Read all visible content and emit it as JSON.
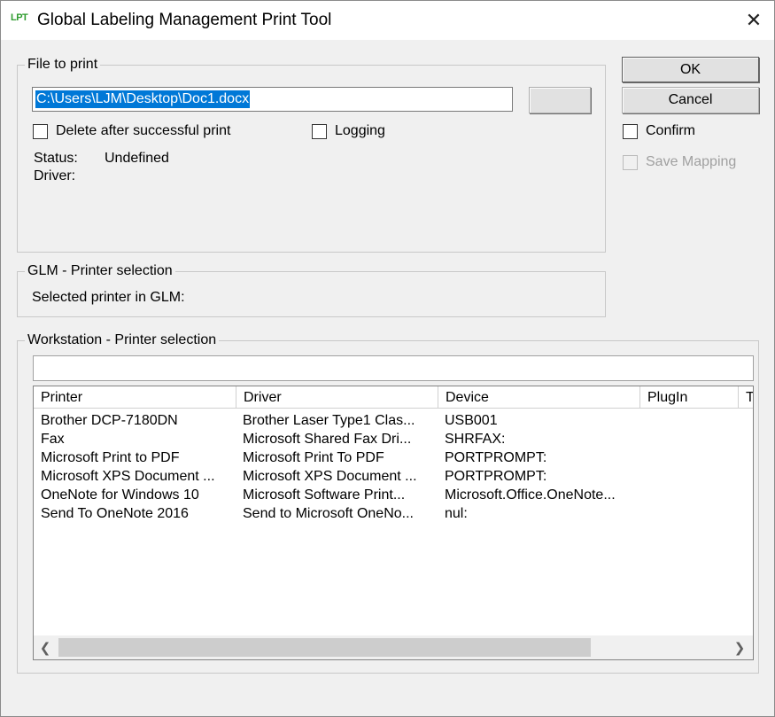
{
  "window": {
    "logo_text": "LPT",
    "title": "Global Labeling Management Print Tool",
    "close_glyph": "✕"
  },
  "file_group": {
    "legend": "File to print",
    "file_path": "C:\\Users\\LJM\\Desktop\\Doc1.docx",
    "browse_label": "",
    "delete_after_label": "Delete after successful print",
    "delete_after_checked": false,
    "logging_label": "Logging",
    "logging_checked": false,
    "status_label": "Status:",
    "status_value": "Undefined",
    "driver_label": "Driver:",
    "driver_value": ""
  },
  "actions": {
    "ok_label": "OK",
    "cancel_label": "Cancel",
    "confirm_label": "Confirm",
    "confirm_checked": false,
    "save_mapping_label": "Save Mapping",
    "save_mapping_enabled": false
  },
  "glm_group": {
    "legend": "GLM - Printer selection",
    "selected_label": "Selected printer in GLM:",
    "selected_value": ""
  },
  "workstation_group": {
    "legend": "Workstation - Printer selection",
    "filter_value": "",
    "columns": [
      "Printer",
      "Driver",
      "Device",
      "PlugIn",
      "T"
    ],
    "rows": [
      [
        "Brother DCP-7180DN",
        "Brother Laser Type1 Clas...",
        "USB001",
        ""
      ],
      [
        "Fax",
        "Microsoft Shared Fax Dri...",
        "SHRFAX:",
        ""
      ],
      [
        "Microsoft Print to PDF",
        "Microsoft Print To PDF",
        "PORTPROMPT:",
        ""
      ],
      [
        "Microsoft XPS Document ...",
        "Microsoft XPS Document ...",
        "PORTPROMPT:",
        ""
      ],
      [
        "OneNote for Windows 10",
        "Microsoft Software Print...",
        "Microsoft.Office.OneNote...",
        ""
      ],
      [
        "Send To OneNote 2016",
        "Send to Microsoft OneNo...",
        "nul:",
        ""
      ]
    ],
    "scroll_left_glyph": "❮",
    "scroll_right_glyph": "❯"
  }
}
